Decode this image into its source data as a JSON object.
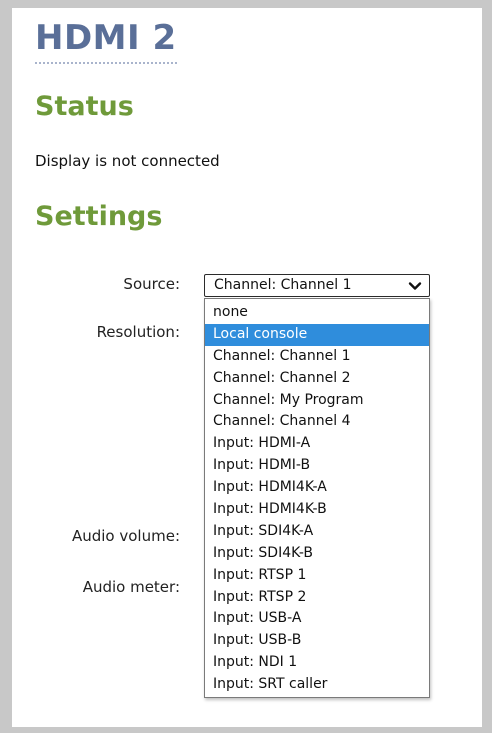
{
  "page": {
    "title": "HDMI 2"
  },
  "status": {
    "heading": "Status",
    "text": "Display is not connected"
  },
  "settings": {
    "heading": "Settings",
    "labels": {
      "source": "Source:",
      "resolution": "Resolution:",
      "audio_volume": "Audio volume:",
      "audio_meter": "Audio meter:"
    },
    "source_select": {
      "value": "Channel: Channel 1",
      "chevron_icon": "chevron-down-icon",
      "highlighted_option": "Local console",
      "options": [
        "none",
        "Local console",
        "Channel: Channel 1",
        "Channel: Channel 2",
        "Channel: My Program",
        "Channel: Channel 4",
        "Input: HDMI-A",
        "Input: HDMI-B",
        "Input: HDMI4K-A",
        "Input: HDMI4K-B",
        "Input: SDI4K-A",
        "Input: SDI4K-B",
        "Input: RTSP 1",
        "Input: RTSP 2",
        "Input: USB-A",
        "Input: USB-B",
        "Input: NDI 1",
        "Input: SRT caller"
      ]
    }
  },
  "colors": {
    "title": "#5a6f98",
    "section_heading": "#6f9a3a",
    "highlight": "#2f8ddc",
    "frame": "#c8c8c8"
  }
}
